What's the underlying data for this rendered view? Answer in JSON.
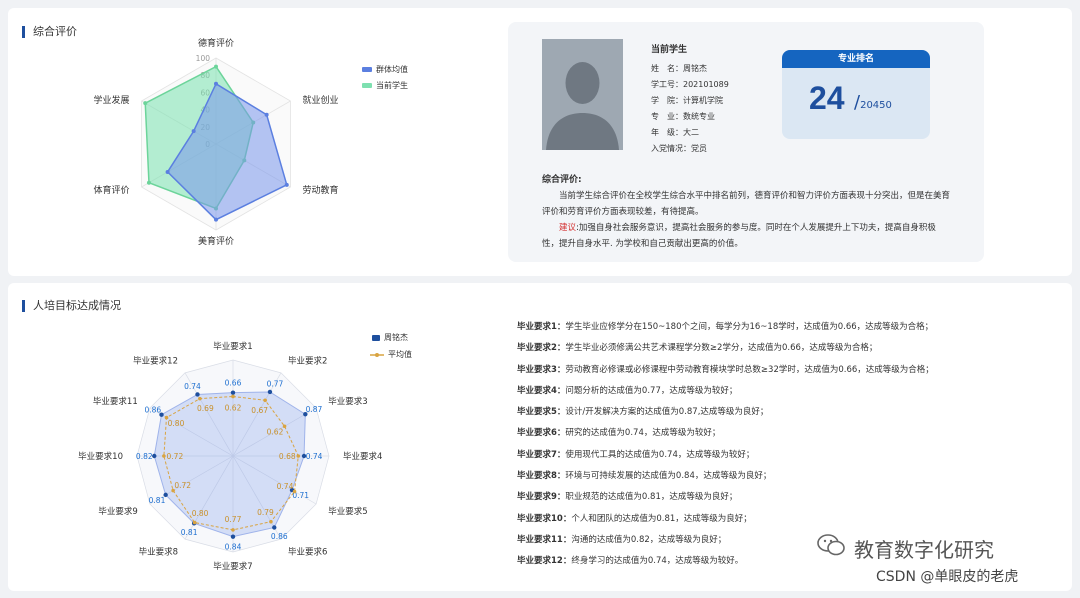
{
  "section1": {
    "title": "综合评价",
    "radar": {
      "axes": [
        "德育评价",
        "就业创业",
        "劳动教育",
        "美育评价",
        "体育评价",
        "学业发展"
      ],
      "ticks": [
        "100",
        "80",
        "60",
        "40",
        "20",
        "0"
      ]
    },
    "legend": [
      {
        "label": "群体均值",
        "color": "#5b7fe0"
      },
      {
        "label": "当前学生",
        "color": "#7ee0b0"
      }
    ]
  },
  "chart_data": [
    {
      "type": "radar",
      "categories": [
        "德育评价",
        "就业创业",
        "劳动教育",
        "美育评价",
        "体育评价",
        "学业发展"
      ],
      "range": [
        0,
        100
      ],
      "series": [
        {
          "name": "群体均值",
          "values": [
            70,
            68,
            95,
            88,
            65,
            30
          ]
        },
        {
          "name": "当前学生",
          "values": [
            90,
            50,
            38,
            75,
            90,
            95
          ]
        }
      ]
    },
    {
      "type": "radar",
      "categories": [
        "毕业要求1",
        "毕业要求2",
        "毕业要求3",
        "毕业要求4",
        "毕业要求5",
        "毕业要求6",
        "毕业要求7",
        "毕业要求8",
        "毕业要求9",
        "毕业要求10",
        "毕业要求11",
        "毕业要求12"
      ],
      "series": [
        {
          "name": "周铭杰",
          "values": [
            0.66,
            0.77,
            0.87,
            0.74,
            0.71,
            0.86,
            0.84,
            0.81,
            0.81,
            0.82,
            0.86,
            0.74
          ]
        },
        {
          "name": "平均值",
          "values": [
            0.62,
            0.67,
            0.62,
            0.68,
            0.74,
            0.79,
            0.77,
            0.8,
            0.72,
            0.72,
            0.8,
            0.69
          ]
        }
      ]
    }
  ],
  "student": {
    "header": "当前学生",
    "fields": [
      {
        "label": "姓　名：",
        "value": "周铭杰"
      },
      {
        "label": "学工号：",
        "value": "202101089"
      },
      {
        "label": "学　院：",
        "value": "计算机学院"
      },
      {
        "label": "专　业：",
        "value": "数统专业"
      },
      {
        "label": "年　级：",
        "value": "大二"
      },
      {
        "label": "入党情况：",
        "value": "党员"
      }
    ],
    "rank": {
      "title": "专业排名",
      "value": "24",
      "total": "20450",
      "slash": "/"
    },
    "evaluation": {
      "title": "综合评价:",
      "text": "当前学生综合评价在全校学生综合水平中排名前列，德育评价和智力评价方面表现十分突出，但是在美育评价和劳育评价方面表现较差，有待提高。",
      "suggest_label": "建议",
      "suggest_text": ":加强自身社会服务意识，提高社会服务的参与度。同时在个人发展提升上下功夫，提高自身积极性，提升自身水平. 为学校和自己贡献出更高的价值。"
    }
  },
  "section2": {
    "title": "人培目标达成情况",
    "legend": [
      {
        "label": "周铭杰",
        "color": "#1e4f9e"
      },
      {
        "label": "平均值",
        "color": "#d9a441"
      }
    ],
    "requirements": [
      {
        "label": "毕业要求1：",
        "text": "学生毕业应修学分在150~180个之间，每学分为16~18学时，达成值为0.66，达成等级为合格；"
      },
      {
        "label": "毕业要求2：",
        "text": "学生毕业必须修满公共艺术课程学分数≥2学分，达成值为0.66，达成等级为合格；"
      },
      {
        "label": "毕业要求3：",
        "text": "劳动教育必修课或必修课程中劳动教育模块学时总数≥32学时，达成值为0.66，达成等级为合格；"
      },
      {
        "label": "毕业要求4：",
        "text": "问题分析的达成值为0.77，达成等级为较好；"
      },
      {
        "label": "毕业要求5：",
        "text": "设计/开发解决方案的达成值为0.87,达成等级为良好；"
      },
      {
        "label": "毕业要求6：",
        "text": "研究的达成值为0.74，达成等级为较好；"
      },
      {
        "label": "毕业要求7：",
        "text": "使用现代工具的达成值为0.74，达成等级为较好；"
      },
      {
        "label": "毕业要求8：",
        "text": "环境与可持续发展的达成值为0.84，达成等级为良好；"
      },
      {
        "label": "毕业要求9：",
        "text": "职业规范的达成值为0.81，达成等级为良好；"
      },
      {
        "label": "毕业要求10：",
        "text": "个人和团队的达成值为0.81，达成等级为良好；"
      },
      {
        "label": "毕业要求11：",
        "text": "沟通的达成值为0.82，达成等级为良好；"
      },
      {
        "label": "毕业要求12：",
        "text": "终身学习的达成值为0.74，达成等级为较好。"
      }
    ]
  },
  "watermark": {
    "line1": "教育数字化研究",
    "line2": "CSDN @单眼皮的老虎"
  }
}
